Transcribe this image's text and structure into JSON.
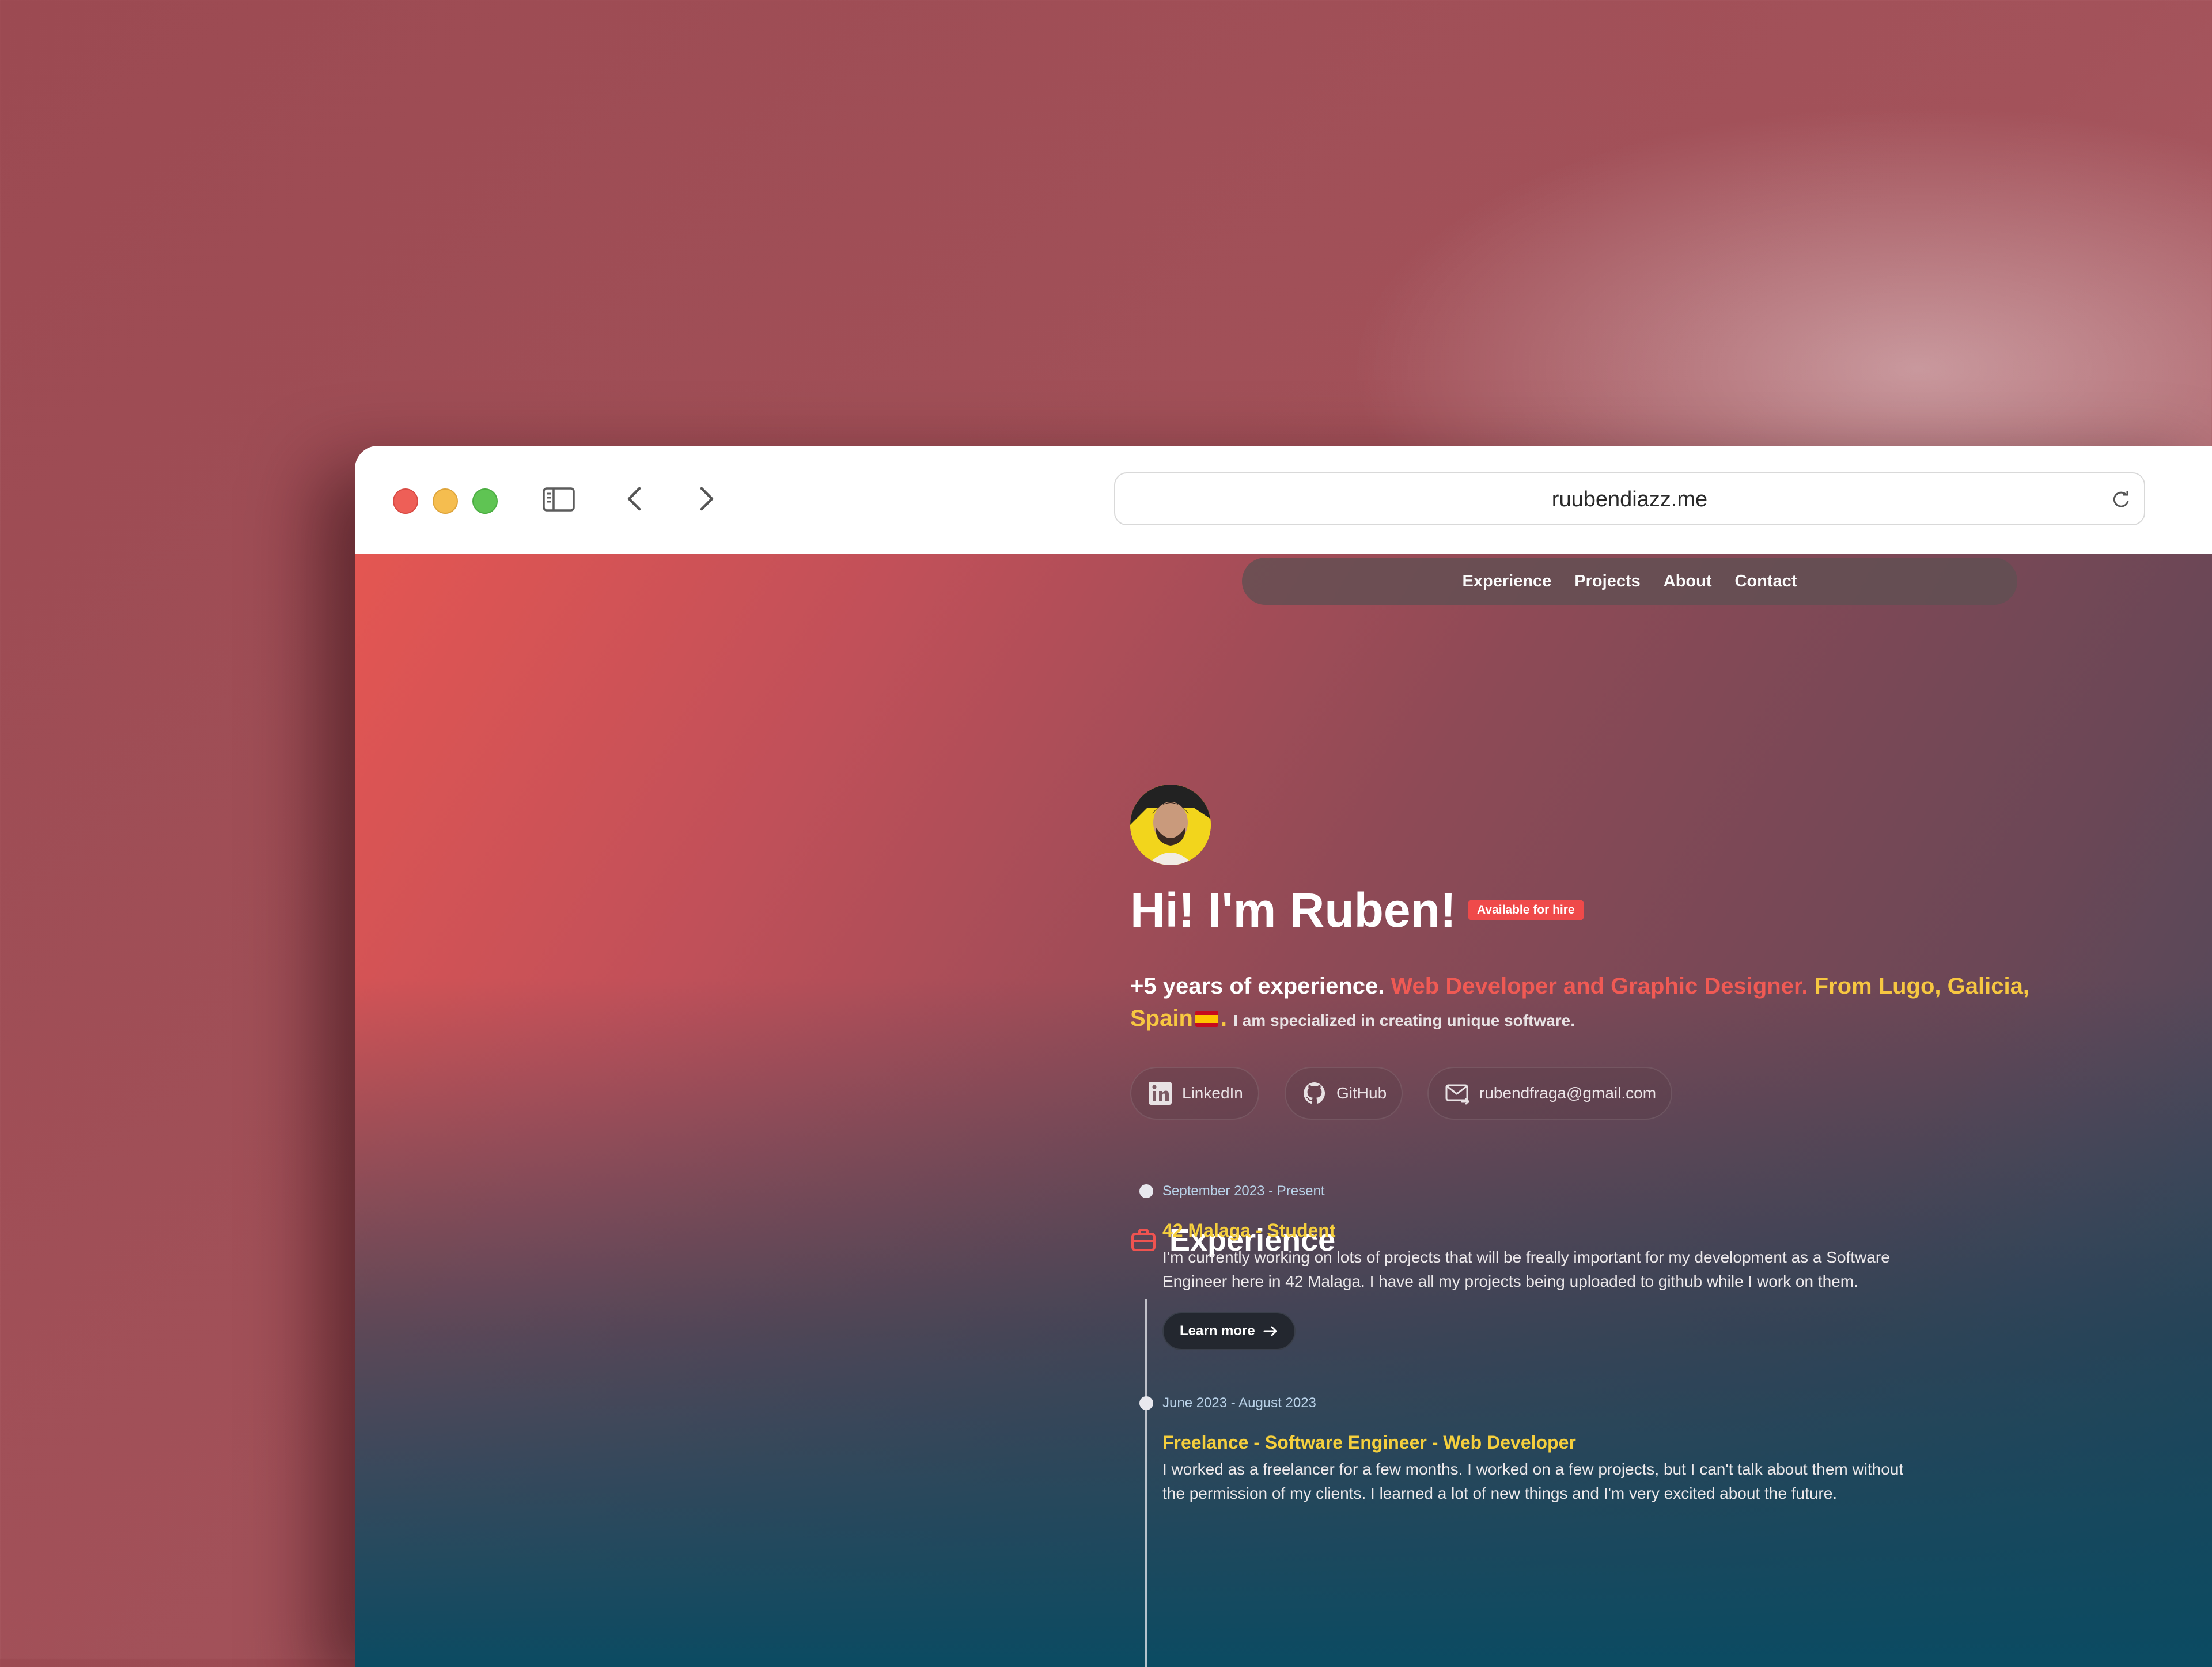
{
  "browser": {
    "url": "ruubendiazz.me"
  },
  "nav": {
    "items": [
      "Experience",
      "Projects",
      "About",
      "Contact"
    ]
  },
  "hero": {
    "title": "Hi! I'm Ruben!",
    "badge": "Available for hire",
    "intro_white": "+5 years of experience.",
    "intro_red": "Web Developer and Graphic Designer.",
    "intro_yellow_1": "From Lugo,",
    "intro_yellow_2": "Galicia, Spain",
    "intro_yellow_end": ".",
    "intro_small": "I am specialized in creating unique software."
  },
  "social": {
    "linkedin": "LinkedIn",
    "github": "GitHub",
    "email": "rubendfraga@gmail.com"
  },
  "experience": {
    "heading": "Experience",
    "items": [
      {
        "date": "September 2023 - Present",
        "role": "42 Malaga - Student",
        "desc": "I'm currently working on lots of projects that will be freally important for my development as a Software Engineer here in 42 Malaga. I have all my projects being uploaded to github while I work on them.",
        "button": "Learn more"
      },
      {
        "date": "June 2023 - August 2023",
        "role": "Freelance - Software Engineer - Web Developer",
        "desc": "I worked as a freelancer for a few months. I worked on a few projects, but I can't talk about them without the permission of my clients. I learned a lot of new things and I'm very excited about the future."
      }
    ]
  },
  "icons": [
    "sidebar-icon",
    "back-arrow-icon",
    "forward-arrow-icon",
    "reload-icon",
    "linkedin-icon",
    "github-icon",
    "mail-icon",
    "briefcase-icon",
    "spain-flag-icon"
  ],
  "colors": {
    "accent_red": "#f05a54",
    "accent_yellow": "#f5cf3d",
    "badge": "#ef4a4a"
  }
}
